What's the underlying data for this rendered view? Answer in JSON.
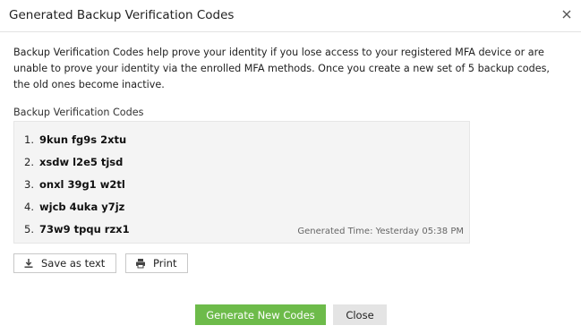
{
  "dialog": {
    "title": "Generated Backup Verification Codes",
    "close_icon": "close-icon"
  },
  "description": "Backup Verification Codes help prove your identity if you lose access to your registered MFA device or are unable to prove your identity via the enrolled MFA methods. Once you create a new set of 5 backup codes, the old ones become inactive.",
  "codes_section": {
    "label": "Backup Verification Codes",
    "codes": [
      {
        "num": "1.",
        "code": "9kun fg9s 2xtu"
      },
      {
        "num": "2.",
        "code": "xsdw l2e5 tjsd"
      },
      {
        "num": "3.",
        "code": "onxl 39g1 w2tl"
      },
      {
        "num": "4.",
        "code": "wjcb 4uka y7jz"
      },
      {
        "num": "5.",
        "code": "73w9 tpqu rzx1"
      }
    ],
    "generated_time": "Generated Time: Yesterday 05:38 PM"
  },
  "actions": {
    "save_label": "Save as text",
    "save_icon": "download-icon",
    "print_label": "Print",
    "print_icon": "printer-icon"
  },
  "footer": {
    "generate_label": "Generate New Codes",
    "close_label": "Close"
  },
  "colors": {
    "primary": "#6dbb4a",
    "secondary": "#e4e4e4"
  }
}
